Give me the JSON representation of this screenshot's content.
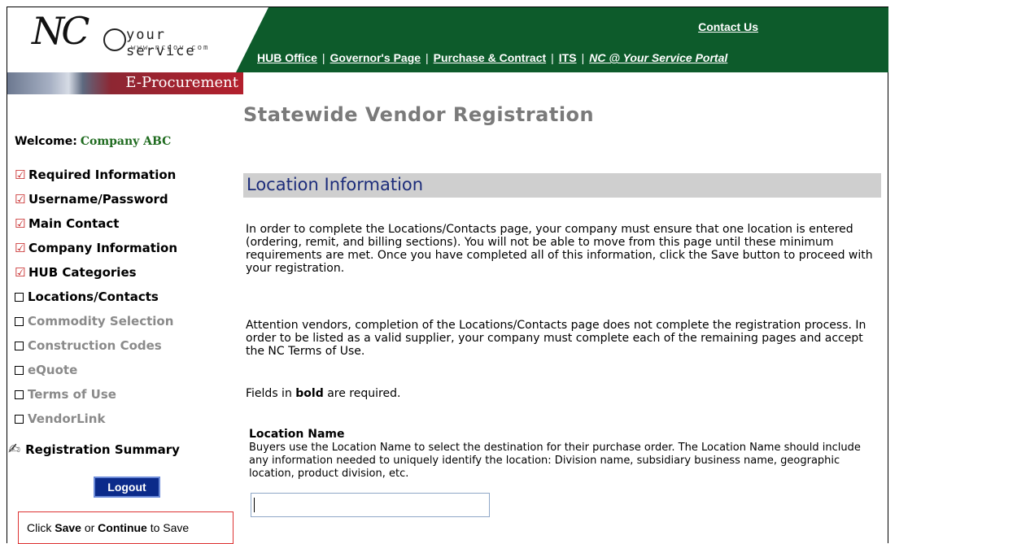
{
  "header": {
    "logo_script": "NC",
    "logo_service": "your service",
    "logo_url": "www.ncgov.com",
    "eprocurement": "E-Procurement",
    "contact_us": "Contact Us",
    "nav": [
      "HUB Office",
      "Governor's Page",
      "Purchase & Contract",
      "ITS",
      "NC @ Your Service Portal"
    ],
    "brand_green": "#0d5b2b"
  },
  "sidebar": {
    "welcome_label": "Welcome:",
    "company": "Company ABC",
    "steps": [
      {
        "label": "Required Information",
        "state": "done"
      },
      {
        "label": "Username/Password",
        "state": "done"
      },
      {
        "label": "Main Contact",
        "state": "done"
      },
      {
        "label": "Company Information",
        "state": "done"
      },
      {
        "label": "HUB Categories",
        "state": "done"
      },
      {
        "label": "Locations/Contacts",
        "state": "current"
      },
      {
        "label": "Commodity Selection",
        "state": "todo"
      },
      {
        "label": "Construction Codes",
        "state": "todo"
      },
      {
        "label": "eQuote",
        "state": "todo"
      },
      {
        "label": "Terms of Use",
        "state": "todo"
      },
      {
        "label": "VendorLink",
        "state": "todo"
      }
    ],
    "summary": "Registration Summary",
    "logout": "Logout",
    "save_hint": {
      "pre": "Click ",
      "save": "Save",
      "mid": " or ",
      "cont": "Continue",
      "post": " to Save"
    }
  },
  "main": {
    "page_title": "Statewide Vendor Registration",
    "section_title": "Location Information",
    "para1": "In order to complete the Locations/Contacts page, your company must ensure that one location is entered (ordering, remit, and billing sections). You will not be able to move from this page until these minimum requirements are met. Once you have completed all of this information, click the Save button to proceed with your registration.",
    "para2": "Attention vendors, completion of the Locations/Contacts page does not complete the registration process. In order to be listed as a valid supplier, your company must complete each of the remaining pages and accept the NC Terms of Use.",
    "para3_pre": "Fields in ",
    "para3_bold": "bold",
    "para3_post": " are required.",
    "location_label_bold": "Location",
    "location_label_rest": " Name",
    "location_help": "Buyers use the Location Name to select the destination for their purchase order. The Location Name should include any information needed to uniquely identify the location: Division name, subsidiary business name, geographic location, product division, etc.",
    "location_value": ""
  }
}
